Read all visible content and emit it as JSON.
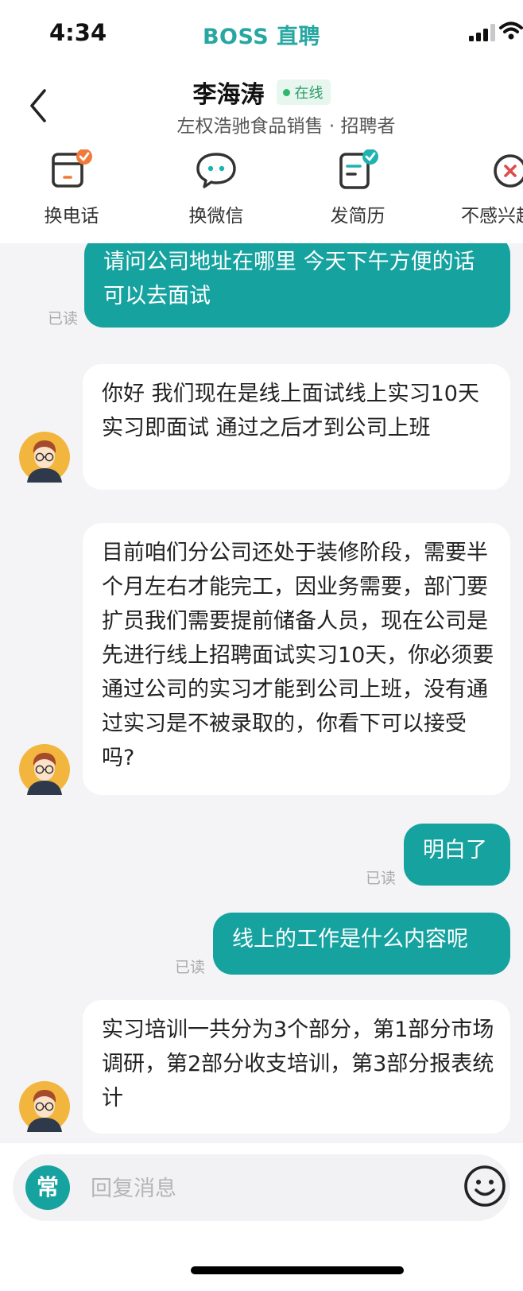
{
  "status_bar": {
    "time": "4:34",
    "brand": "BOSS 直聘"
  },
  "header": {
    "contact_name": "李海涛",
    "online_label": "在线",
    "subtitle": "左权浩驰食品销售 · 招聘者"
  },
  "actions": [
    {
      "label": "换电话",
      "icon": "phone-swap-icon"
    },
    {
      "label": "换微信",
      "icon": "wechat-icon"
    },
    {
      "label": "发简历",
      "icon": "resume-icon"
    },
    {
      "label": "不感兴趣",
      "icon": "not-interested-icon"
    }
  ],
  "messages": [
    {
      "from": "me",
      "text": "请问公司地址在哪里 今天下午方便的话可以去面试",
      "status": "已读"
    },
    {
      "from": "them",
      "text": "你好 我们现在是线上面试线上实习10天 实习即面试 通过之后才到公司上班"
    },
    {
      "from": "them",
      "text": "目前咱们分公司还处于装修阶段，需要半个月左右才能完工，因业务需要，部门要扩员我们需要提前储备人员，现在公司是先进行线上招聘面试实习10天，你必须要通过公司的实习才能到公司上班，没有通过实习是不被录取的，你看下可以接受吗?"
    },
    {
      "from": "me",
      "text": "明白了",
      "status": "已读"
    },
    {
      "from": "me",
      "text": "线上的工作是什么内容呢",
      "status": "已读"
    },
    {
      "from": "them",
      "text": "实习培训一共分为3个部分，第1部分市场调研，第2部分收支培训，第3部分报表统计"
    }
  ],
  "input": {
    "quick_reply_label": "常",
    "placeholder": "回复消息"
  },
  "colors": {
    "brand": "#27a7a2",
    "my_bubble": "#16a3a0",
    "online": "#2fb86a",
    "badge_orange": "#f07a3a",
    "badge_teal": "#1eb3b0",
    "not_interested_red": "#e04b4b"
  }
}
